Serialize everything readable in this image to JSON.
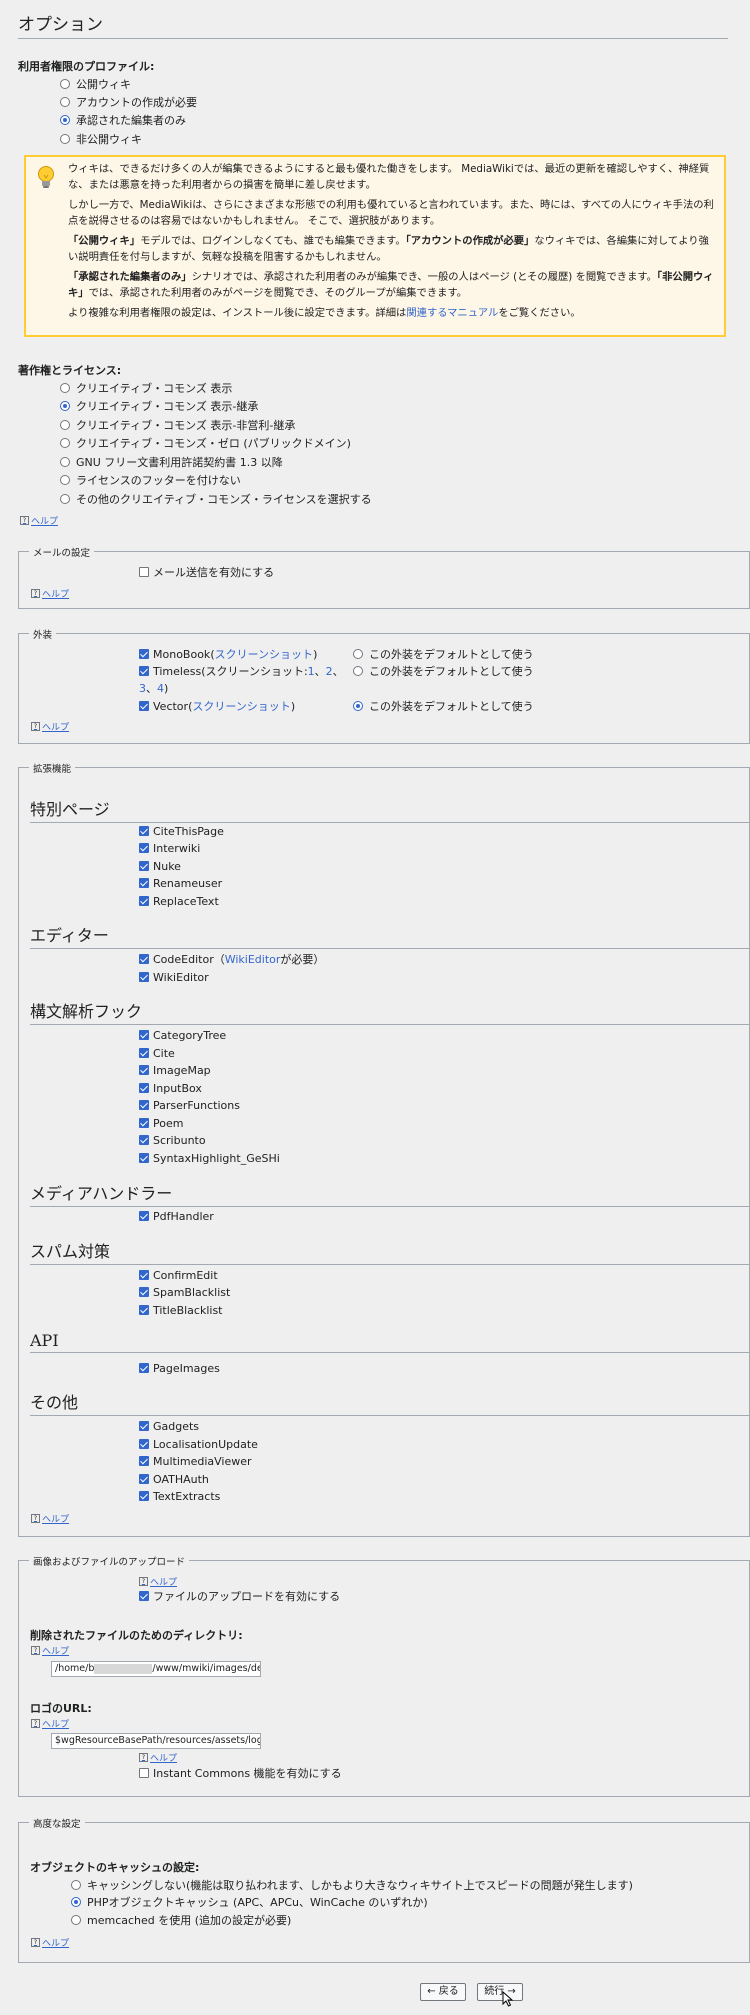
{
  "page_title": "オプション",
  "permissions": {
    "label": "利用者権限のプロファイル:",
    "options": [
      {
        "label": "公開ウィキ",
        "selected": false
      },
      {
        "label": "アカウントの作成が必要",
        "selected": false
      },
      {
        "label": "承認された編集者のみ",
        "selected": true
      },
      {
        "label": "非公開ウィキ",
        "selected": false
      }
    ]
  },
  "notice": {
    "p1": "ウィキは、できるだけ多くの人が編集できるようにすると最も優れた働きをします。 MediaWikiでは、最近の更新を確認しやすく、神経質な、または悪意を持った利用者からの損害を簡単に差し戻せます。",
    "p2": "しかし一方で、MediaWikiは、さらにさまざまな形態での利用も優れていると言われています。また、時には、すべての人にウィキ手法の利点を説得させるのは容易ではないかもしれません。 そこで、選択肢があります。",
    "p3_b1": "「公開ウィキ」",
    "p3_t1": "モデルでは、ログインしなくても、誰でも編集できます。",
    "p3_b2": "「アカウントの作成が必要」",
    "p3_t2": "なウィキでは、各編集に対してより強い説明責任を付与しますが、気軽な投稿を阻害するかもしれません。",
    "p4_b1": "「承認された編集者のみ」",
    "p4_t1": "シナリオでは、承認された利用者のみが編集でき、一般の人はページ (とその履歴) を閲覧できます。",
    "p4_b2": "「非公開ウィキ」",
    "p4_t2": "では、承認された利用者のみがページを閲覧でき、そのグループが編集できます。",
    "p5_t1": "より複雑な利用者権限の設定は、インストール後に設定できます。詳細は",
    "p5_link": "関連するマニュアル",
    "p5_t2": "をご覧ください。"
  },
  "license": {
    "label": "著作権とライセンス:",
    "options": [
      {
        "label": "クリエイティブ・コモンズ 表示",
        "selected": false
      },
      {
        "label": "クリエイティブ・コモンズ 表示-継承",
        "selected": true
      },
      {
        "label": "クリエイティブ・コモンズ 表示-非営利-継承",
        "selected": false
      },
      {
        "label": "クリエイティブ・コモンズ・ゼロ (パブリックドメイン)",
        "selected": false
      },
      {
        "label": "GNU フリー文書利用許諾契約書 1.3 以降",
        "selected": false
      },
      {
        "label": "ライセンスのフッターを付けない",
        "selected": false
      },
      {
        "label": "その他のクリエイティブ・コモンズ・ライセンスを選択する",
        "selected": false
      }
    ]
  },
  "help_label": "ヘルプ",
  "qmark": "?",
  "email": {
    "legend": "メールの設定",
    "checkbox": "メール送信を有効にする"
  },
  "skins": {
    "legend": "外装",
    "default_label": "この外装をデフォルトとして使う",
    "monobook": {
      "name": "MonoBook",
      "open": " (",
      "link": "スクリーンショット",
      "close": ")"
    },
    "timeless": {
      "name": "Timeless",
      "text": " (スクリーンショット: ",
      "l1": "1",
      "l2": "2",
      "l3": "3",
      "l4": "4",
      "sep": "、",
      "close": ")"
    },
    "vector": {
      "name": "Vector",
      "open": " (",
      "link": "スクリーンショット",
      "close": ")"
    }
  },
  "extensions": {
    "legend": "拡張機能",
    "special": {
      "heading": "特別ページ",
      "items": [
        "CiteThisPage",
        "Interwiki",
        "Nuke",
        "Renameuser",
        "ReplaceText"
      ]
    },
    "editors": {
      "heading": "エディター",
      "code_editor": "CodeEditor",
      "code_pre": "（",
      "code_link": "WikiEditor",
      "code_post": "が必要）",
      "wiki_editor": "WikiEditor"
    },
    "parser": {
      "heading": "構文解析フック",
      "items": [
        "CategoryTree",
        "Cite",
        "ImageMap",
        "InputBox",
        "ParserFunctions",
        "Poem",
        "Scribunto",
        "SyntaxHighlight_GeSHi"
      ]
    },
    "media": {
      "heading": "メディアハンドラー",
      "items": [
        "PdfHandler"
      ]
    },
    "spam": {
      "heading": "スパム対策",
      "items": [
        "ConfirmEdit",
        "SpamBlacklist",
        "TitleBlacklist"
      ]
    },
    "api": {
      "heading": "API",
      "items": [
        "PageImages"
      ]
    },
    "other": {
      "heading": "その他",
      "items": [
        "Gadgets",
        "LocalisationUpdate",
        "MultimediaViewer",
        "OATHAuth",
        "TextExtracts"
      ]
    }
  },
  "uploads": {
    "legend": "画像およびファイルのアップロード",
    "enable_uploads": "ファイルのアップロードを有効にする",
    "deleted_dir_label": "削除されたファイルのためのディレクトリ:",
    "deleted_dir_prefix": "/home/b",
    "deleted_dir_suffix": "/www/mwiki/images/dele",
    "logo_label": "ロゴのURL:",
    "logo_value": "$wgResourceBasePath/resources/assets/log",
    "instant_commons": "Instant Commons 機能を有効にする"
  },
  "advanced": {
    "legend": "高度な設定",
    "cache_label": "オブジェクトのキャッシュの設定:",
    "options": [
      {
        "label": "キャッシングしない(機能は取り払われます、しかもより大きなウィキサイト上でスピードの問題が発生します)",
        "selected": false
      },
      {
        "label": "PHPオブジェクトキャッシュ (APC、APCu、WinCache のいずれか)",
        "selected": true
      },
      {
        "label": "memcached を使用 (追加の設定が必要)",
        "selected": false
      }
    ]
  },
  "nav": {
    "back": "← 戻る",
    "continue": "続行 →"
  },
  "colors": {
    "accent": "#3366cc",
    "notice_border": "#ffcc33",
    "notice_bg": "#fef6e7"
  }
}
